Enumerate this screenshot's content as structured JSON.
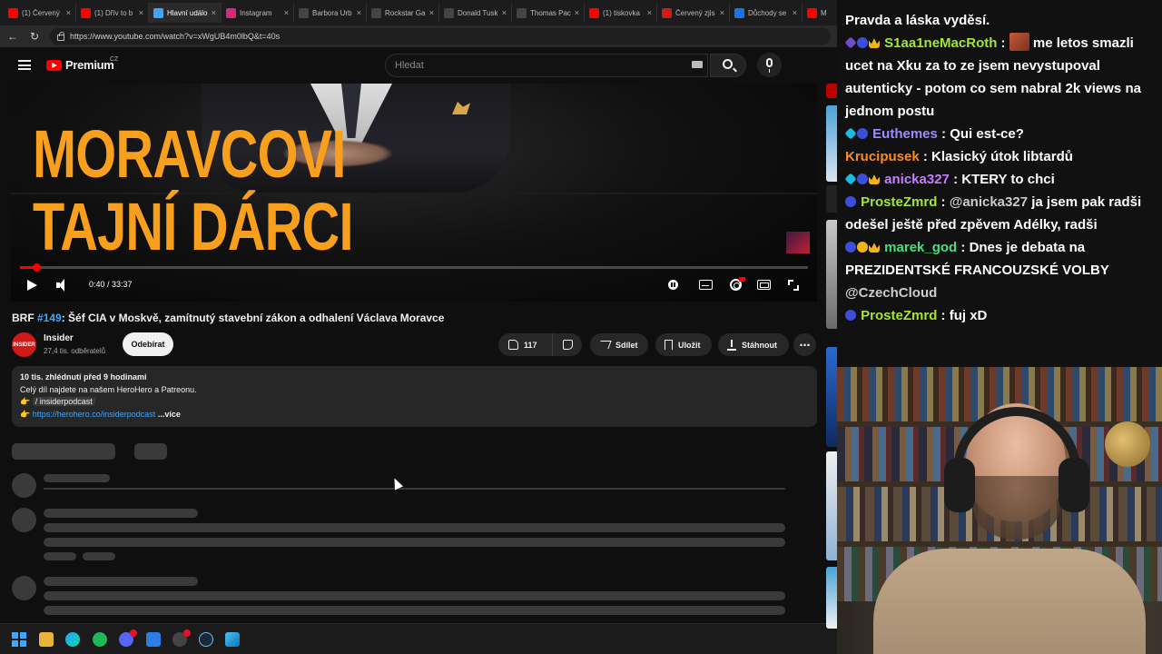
{
  "browser": {
    "tabs": [
      {
        "label": "(1) Červený",
        "color": "#ff0000",
        "glyph": "youtube-icon"
      },
      {
        "label": "(1) Dřív to b",
        "color": "#ff0000",
        "glyph": "youtube-icon"
      },
      {
        "label": "Hlavní událo",
        "color": "#3ea6ff",
        "glyph": "document-icon"
      },
      {
        "label": "Instagram",
        "color": "#d62976",
        "glyph": "instagram-icon"
      },
      {
        "label": "Barbora Urb",
        "color": "#444444",
        "glyph": "x-icon"
      },
      {
        "label": "Rockstar Ga",
        "color": "#444444",
        "glyph": "x-icon"
      },
      {
        "label": "Donald Tusk",
        "color": "#444444",
        "glyph": "x-icon"
      },
      {
        "label": "Thomas Pac",
        "color": "#444444",
        "glyph": "x-icon"
      },
      {
        "label": "(1) tiskovka",
        "color": "#ff0000",
        "glyph": "youtube-icon"
      },
      {
        "label": "Červený zjis",
        "color": "#d01a1a",
        "glyph": "news-icon"
      },
      {
        "label": "Důchody se",
        "color": "#1a73e8",
        "glyph": "news-icon"
      },
      {
        "label": "M",
        "color": "#ff0000",
        "glyph": "youtube-icon"
      }
    ],
    "url": "https://www.youtube.com/watch?v=xWgUB4m0lbQ&t=40s"
  },
  "youtube": {
    "logo_text": "Premium",
    "region": "CZ",
    "search_placeholder": "Hledat"
  },
  "player": {
    "thumbnail_line1": "MORAVCOVI",
    "thumbnail_line2": "TAJNÍ DÁRCI",
    "time": "0:40 / 33:37",
    "progress": 0.02,
    "accent": "#ff0000",
    "title_color": "#f8a01e"
  },
  "video": {
    "title_prefix": "BRF ",
    "title_episode": "#149",
    "title_rest": ": Šéf CIA v Moskvě, zamítnutý stavební zákon a odhalení Václava Moravce",
    "channel_name": "Insider",
    "channel_avatar_text": "INSIDER",
    "subscribers": "27,4 tis. odběratelů",
    "subscribe_label": "Odebírat",
    "likes": "117",
    "share_label": "Sdílet",
    "save_label": "Uložit",
    "download_label": "Stáhnout",
    "more_label": "⋯"
  },
  "description": {
    "stats": "10 tis. zhlédnutí  před 9 hodinami",
    "line1": "Celý díl najdete na našem HeroHero a Patreonu.",
    "line2_prefix": "👉 ",
    "line2_chip": "/ insiderpodcast",
    "line3_prefix": "👉 ",
    "line3_link": "https://herohero.co/insiderpodcast",
    "more_label": "...více"
  },
  "chat": {
    "messages": [
      {
        "badges": [],
        "user": "",
        "user_color": "#ffffff",
        "text": "Pravda a láska vyděsí."
      },
      {
        "badges": [
          "gem",
          "sub",
          "crown"
        ],
        "user": "S1aa1neMacRoth",
        "user_color": "#a3e635",
        "emote": true,
        "text": "me letos smazli ucet na Xku za to ze jsem nevystupoval autenticky - potom co sem nabral 2k views na jednom postu"
      },
      {
        "badges": [
          "cyan",
          "sub"
        ],
        "user": "Euthemes",
        "user_color": "#9b8cff",
        "text": "Qui est-ce?"
      },
      {
        "badges": [],
        "user": "Krucipusek",
        "user_color": "#ff8c1a",
        "text": "Klasický útok libtardů"
      },
      {
        "badges": [
          "cyan",
          "sub",
          "crown"
        ],
        "user": "anicka327",
        "user_color": "#c77dff",
        "text": "KTERY to chci"
      },
      {
        "badges": [
          "sub"
        ],
        "user": "ProsteZmrd",
        "user_color": "#a3e635",
        "mention": "@anicka327",
        "text": "ja jsem pak radši odešel ještě před zpěvem Adélky, radši"
      },
      {
        "badges": [
          "sub",
          "num",
          "crown"
        ],
        "user": "marek_god",
        "user_color": "#4ade80",
        "text": "Dnes je debata na PREZIDENTSKÉ FRANCOUZSKÉ VOLBY",
        "mention_after": "@CzechCloud"
      },
      {
        "badges": [
          "sub"
        ],
        "user": "ProsteZmrd",
        "user_color": "#a3e635",
        "text": "fuj xD"
      }
    ]
  }
}
